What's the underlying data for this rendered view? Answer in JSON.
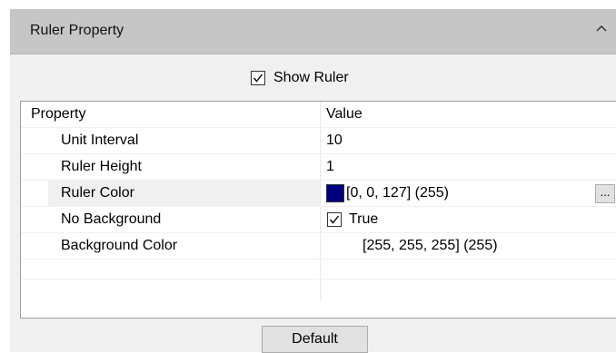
{
  "panel": {
    "title": "Ruler Property",
    "collapse_icon": "chevron-up-icon"
  },
  "show_ruler": {
    "label": "Show Ruler",
    "checked": true
  },
  "grid": {
    "columns": [
      "Property",
      "Value"
    ],
    "rows": [
      {
        "name": "Unit Interval",
        "value": "10"
      },
      {
        "name": "Ruler Height",
        "value": "1"
      },
      {
        "name": "Ruler Color",
        "value": "[0, 0, 127] (255)",
        "swatch": "#00007f",
        "button": "..."
      },
      {
        "name": "No Background",
        "value": "True",
        "checked": true
      },
      {
        "name": "Background Color",
        "value": "[255, 255, 255] (255)"
      }
    ]
  },
  "footer": {
    "default_label": "Default"
  }
}
